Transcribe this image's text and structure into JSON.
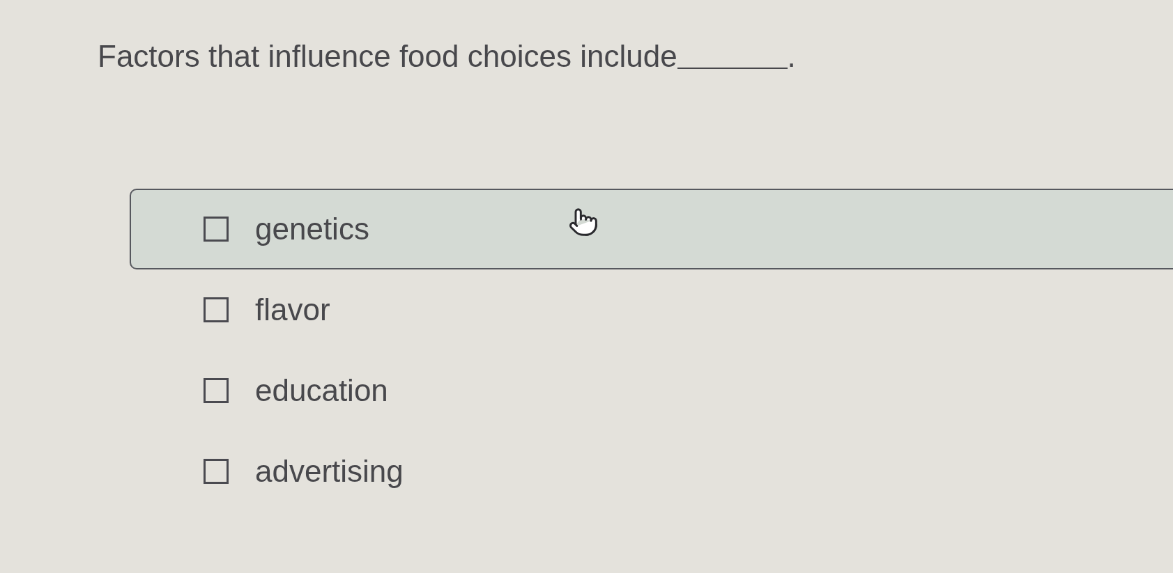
{
  "question": {
    "text": "Factors that influence food choices include",
    "after_blank": "."
  },
  "options": [
    {
      "label": "genetics",
      "checked": false,
      "highlighted": true
    },
    {
      "label": "flavor",
      "checked": false,
      "highlighted": false
    },
    {
      "label": "education",
      "checked": false,
      "highlighted": false
    },
    {
      "label": "advertising",
      "checked": false,
      "highlighted": false
    }
  ]
}
